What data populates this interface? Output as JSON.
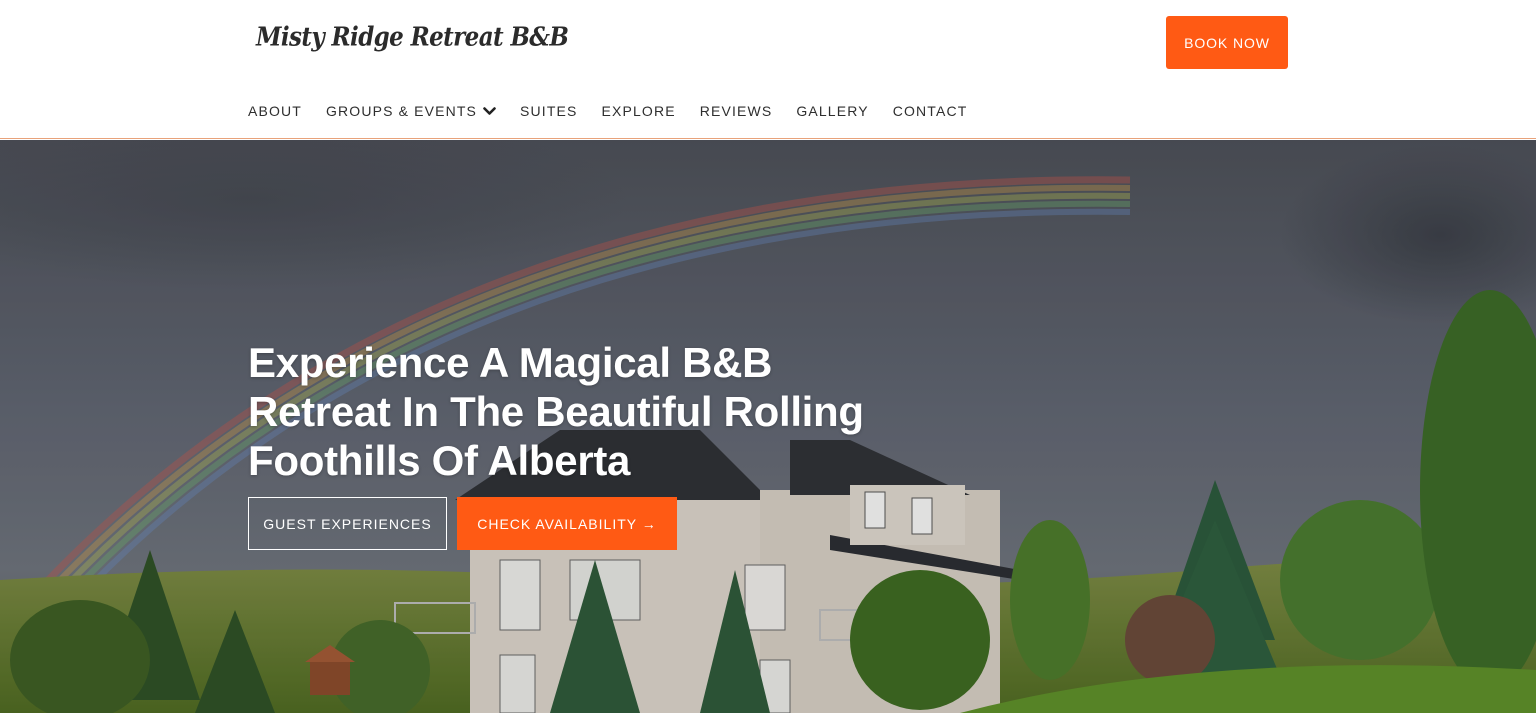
{
  "brand": {
    "logo_text": "Misty Ridge Retreat B&B",
    "accent_color": "#ff5a14"
  },
  "header": {
    "book_now_label": "BOOK NOW"
  },
  "nav": {
    "items": [
      {
        "label": "ABOUT"
      },
      {
        "label": "GROUPS & EVENTS",
        "icon": "chevron-down-icon"
      },
      {
        "label": "SUITES"
      },
      {
        "label": "EXPLORE"
      },
      {
        "label": "REVIEWS"
      },
      {
        "label": "GALLERY"
      },
      {
        "label": "CONTACT"
      }
    ]
  },
  "hero": {
    "title": "Experience A Magical B&B Retreat In The Beautiful Rolling Foothills Of Alberta",
    "primary_button": "GUEST EXPERIENCES",
    "secondary_button": "CHECK AVAILABILITY →",
    "background_image": "house-rainbow-foothills"
  }
}
